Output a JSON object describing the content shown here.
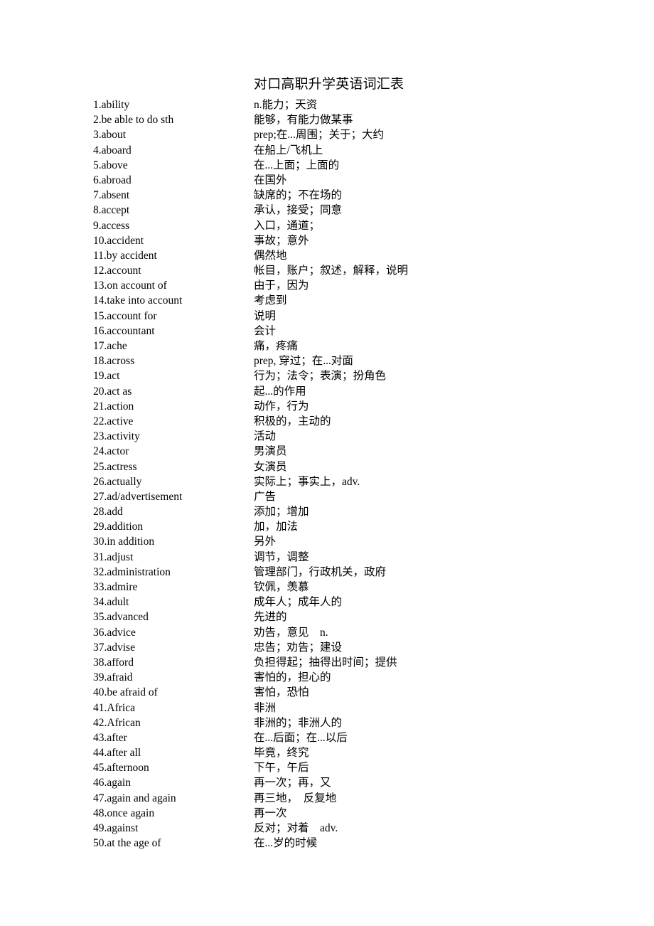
{
  "document": {
    "title": "对口高职升学英语词汇表"
  },
  "entries": [
    {
      "number": "1.",
      "term": "1.ability",
      "meaning": "n.能力；天资"
    },
    {
      "number": "2.",
      "term": "2.be able to do sth",
      "meaning": "能够，有能力做某事"
    },
    {
      "number": "3.",
      "term": "3.about",
      "meaning": "prep;在...周围；关于；大约"
    },
    {
      "number": "4.",
      "term": "4.aboard",
      "meaning": "在船上/飞机上"
    },
    {
      "number": "5.",
      "term": "5.above",
      "meaning": "在...上面；上面的"
    },
    {
      "number": "6.",
      "term": "6.abroad",
      "meaning": "在国外"
    },
    {
      "number": "7.",
      "term": "7.absent",
      "meaning": "缺席的；不在场的"
    },
    {
      "number": "8.",
      "term": "8.accept",
      "meaning": "承认，接受；同意"
    },
    {
      "number": "9.",
      "term": "9.access",
      "meaning": "入口，通道；"
    },
    {
      "number": "10.",
      "term": "10.accident",
      "meaning": "事故；意外"
    },
    {
      "number": "11.",
      "term": "11.by accident",
      "meaning": "偶然地"
    },
    {
      "number": "12.",
      "term": "12.account",
      "meaning": "帐目，账户；叙述，解释，说明"
    },
    {
      "number": "13.",
      "term": "13.on account of",
      "meaning": "由于，因为"
    },
    {
      "number": "14.",
      "term": "14.take into account",
      "meaning": "考虑到"
    },
    {
      "number": "15.",
      "term": "15.account for",
      "meaning": "说明"
    },
    {
      "number": "16.",
      "term": "16.accountant",
      "meaning": "会计"
    },
    {
      "number": "17.",
      "term": "17.ache",
      "meaning": "痛，疼痛"
    },
    {
      "number": "18.",
      "term": "18.across",
      "meaning": "prep, 穿过；在...对面"
    },
    {
      "number": "19.",
      "term": "19.act",
      "meaning": "行为；法令；表演；扮角色"
    },
    {
      "number": "20.",
      "term": "20.act as",
      "meaning": "起...的作用"
    },
    {
      "number": "21.",
      "term": "21.action",
      "meaning": "动作，行为"
    },
    {
      "number": "22.",
      "term": "22.active",
      "meaning": "积极的，主动的"
    },
    {
      "number": "23.",
      "term": "23.activity",
      "meaning": "活动"
    },
    {
      "number": "24.",
      "term": "24.actor",
      "meaning": "男演员"
    },
    {
      "number": "25.",
      "term": "25.actress",
      "meaning": "女演员"
    },
    {
      "number": "26.",
      "term": "26.actually",
      "meaning": "实际上；事实上，adv."
    },
    {
      "number": "27.",
      "term": "27.ad/advertisement",
      "meaning": "广告"
    },
    {
      "number": "28.",
      "term": "28.add",
      "meaning": "添加；增加"
    },
    {
      "number": "29.",
      "term": "29.addition",
      "meaning": "加，加法"
    },
    {
      "number": "30.",
      "term": "30.in addition",
      "meaning": "另外"
    },
    {
      "number": "31.",
      "term": "31.adjust",
      "meaning": "调节，调整"
    },
    {
      "number": "32.",
      "term": "32.administration",
      "meaning": "管理部门，行政机关，政府"
    },
    {
      "number": "33.",
      "term": "33.admire",
      "meaning": "钦佩，羡慕"
    },
    {
      "number": "34.",
      "term": "34.adult",
      "meaning": "成年人；成年人的"
    },
    {
      "number": "35.",
      "term": "35.advanced",
      "meaning": "先进的"
    },
    {
      "number": "36.",
      "term": "36.advice",
      "meaning": "劝告，意见　n."
    },
    {
      "number": "37.",
      "term": "37.advise",
      "meaning": "忠告；劝告；建设"
    },
    {
      "number": "38.",
      "term": "38.afford",
      "meaning": "负担得起；抽得出时间；提供"
    },
    {
      "number": "39.",
      "term": "39.afraid",
      "meaning": "害怕的，担心的"
    },
    {
      "number": "40.",
      "term": "40.be afraid of",
      "meaning": "害怕，恐怕"
    },
    {
      "number": "41.",
      "term": "41.Africa",
      "meaning": "非洲"
    },
    {
      "number": "42.",
      "term": "42.African",
      "meaning": "非洲的；非洲人的"
    },
    {
      "number": "43.",
      "term": "43.after",
      "meaning": "在...后面；在...以后"
    },
    {
      "number": "44.",
      "term": "44.after all",
      "meaning": "毕竟，终究"
    },
    {
      "number": "45.",
      "term": "45.afternoon",
      "meaning": "下午，午后"
    },
    {
      "number": "46.",
      "term": "46.again",
      "meaning": "再一次；再，又"
    },
    {
      "number": "47.",
      "term": "47.again and again",
      "meaning": "再三地，　反复地"
    },
    {
      "number": "48.",
      "term": "48.once again",
      "meaning": "再一次"
    },
    {
      "number": "49.",
      "term": "49.against",
      "meaning": "反对；对着　adv."
    },
    {
      "number": "50.",
      "term": "50.at the age of",
      "meaning": "在...岁的时候"
    }
  ]
}
